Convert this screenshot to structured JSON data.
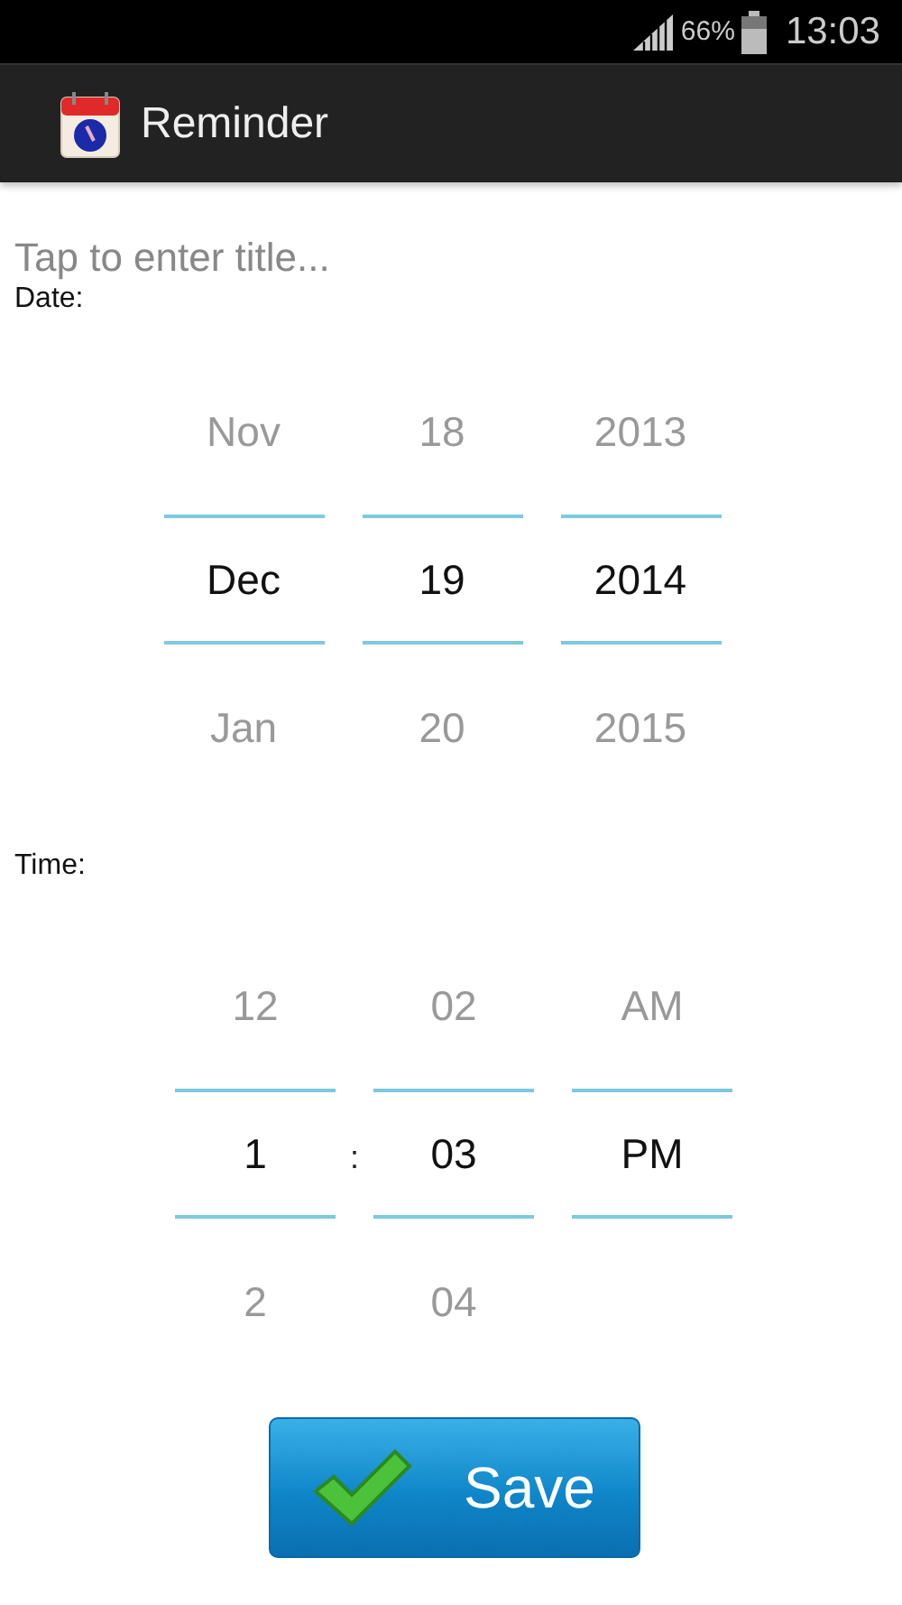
{
  "status_bar": {
    "battery": "66%",
    "time": "13:03"
  },
  "app_bar": {
    "title": "Reminder"
  },
  "title_field": {
    "placeholder": "Tap to enter title..."
  },
  "date_label": "Date:",
  "date_picker": {
    "columns": [
      {
        "above": "Nov",
        "value": "Dec",
        "below": "Jan"
      },
      {
        "above": "18",
        "value": "19",
        "below": "20"
      },
      {
        "above": "2013",
        "value": "2014",
        "below": "2015"
      }
    ]
  },
  "time_label": "Time:",
  "time_picker": {
    "separator": ":",
    "columns": [
      {
        "above": "12",
        "value": "1",
        "below": "2"
      },
      {
        "above": "02",
        "value": "03",
        "below": "04"
      },
      {
        "above": "AM",
        "value": "PM"
      }
    ]
  },
  "save_button": {
    "label": "Save"
  }
}
